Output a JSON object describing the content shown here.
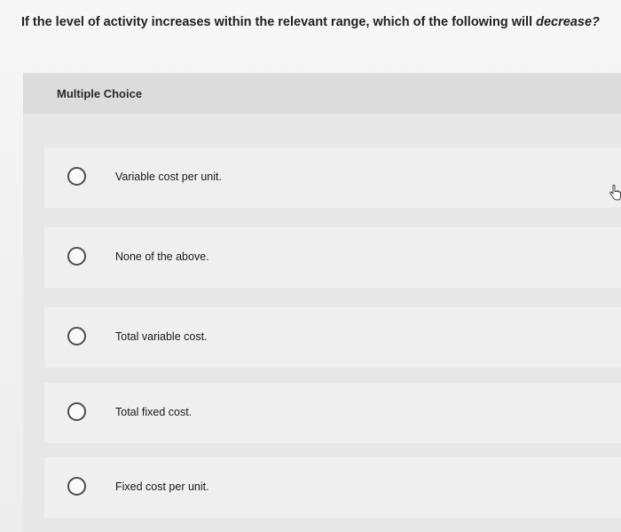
{
  "question": {
    "text_before": "If the level of activity increases within the relevant range, which of the following will ",
    "emphasis": "decrease?"
  },
  "panel": {
    "header": "Multiple Choice"
  },
  "choices": [
    {
      "label": "Variable cost per unit."
    },
    {
      "label": "None of the above."
    },
    {
      "label": "Total variable cost."
    },
    {
      "label": "Total fixed cost."
    },
    {
      "label": "Fixed cost per unit."
    }
  ],
  "icons": {
    "radio": "radio-unselected-icon",
    "cursor": "hand-pointer-cursor-icon"
  }
}
